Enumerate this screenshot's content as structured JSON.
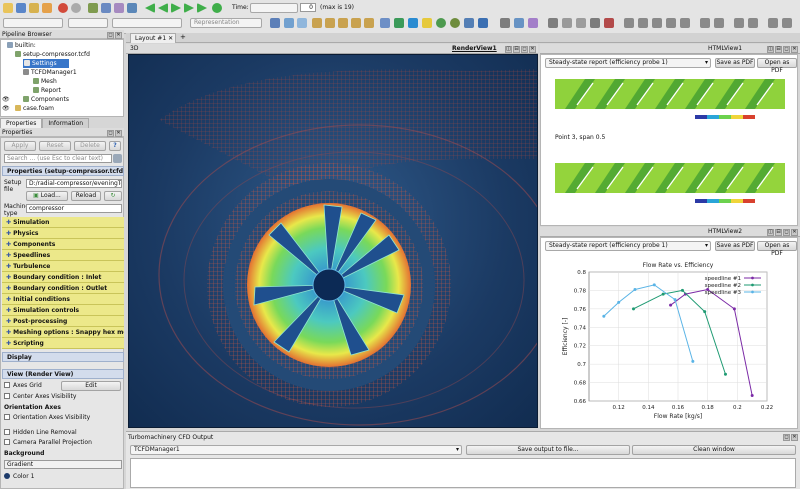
{
  "toolbar": {
    "time_label": "Time:",
    "time_value": "0",
    "time_max": "(max is 19)",
    "representation": "Representation"
  },
  "pipeline": {
    "title": "Pipeline Browser",
    "items": [
      {
        "label": "builtin:"
      },
      {
        "label": "setup-compressor.tcfd"
      },
      {
        "label": "Settings"
      },
      {
        "label": "TCFDManager1"
      },
      {
        "label": "Mesh"
      },
      {
        "label": "Report"
      },
      {
        "label": "Components"
      },
      {
        "label": "case.foam"
      }
    ]
  },
  "tabs": {
    "properties": "Properties",
    "information": "Information"
  },
  "properties": {
    "title": "Properties",
    "apply": "Apply",
    "reset": "Reset",
    "delete": "Delete",
    "help": "?",
    "search_placeholder": "Search ... (use Esc to clear text)",
    "group_title": "Properties (setup-compressor.tcfd)",
    "setup_file_label": "Setup file",
    "setup_file_value": "D:/radial-compressor/eveningTest/s",
    "load": "Load...",
    "reload": "Reload",
    "machine_type_label": "Machine type",
    "machine_type_value": "compressor",
    "sections": [
      "Simulation",
      "Physics",
      "Components",
      "Speedlines",
      "Turbulence",
      "Boundary condition : Inlet",
      "Boundary condition : Outlet",
      "Initial conditions",
      "Simulation controls",
      "Post-processing",
      "Meshing options : Snappy hex mes",
      "Scripting"
    ],
    "display": "Display",
    "view_header": "View (Render View)",
    "axes_grid": "Axes Grid",
    "edit": "Edit",
    "center_axes": "Center Axes Visibility",
    "orientation_axes_title": "Orientation Axes",
    "orientation_axes_vis": "Orientation Axes Visibility",
    "hidden_line": "Hidden Line Removal",
    "camera_parallel": "Camera Parallel Projection",
    "background_title": "Background",
    "background_value": "Gradient",
    "color1": "Color 1"
  },
  "layout_tab": "Layout #1",
  "render_view": {
    "title": "RenderView1"
  },
  "html_view1": {
    "title": "HTMLView1",
    "select": "Steady-state report (efficiency probe 1)",
    "save_pdf": "Save as PDF",
    "open_pdf": "Open as PDF",
    "caption": "Point 3, span 0.5"
  },
  "html_view2": {
    "title": "HTMLView2",
    "select": "Steady-state report (efficiency probe 1)",
    "save_pdf": "Save as PDF",
    "open_pdf": "Open as PDF"
  },
  "output": {
    "title": "Turbomachinery CFD Output",
    "select": "TCFDManager1",
    "save": "Save output to file...",
    "clean": "Clean window"
  },
  "chart_data": {
    "type": "line",
    "title": "Flow Rate vs. Efficiency",
    "xlabel": "Flow Rate [kg/s]",
    "ylabel": "Efficiency [-]",
    "xlim": [
      0.1,
      0.22
    ],
    "ylim": [
      0.66,
      0.8
    ],
    "xticks": [
      "0.12",
      "0.14",
      "0.16",
      "0.18",
      "0.2",
      "0.22"
    ],
    "yticks": [
      "0.66",
      "0.68",
      "0.7",
      "0.72",
      "0.74",
      "0.76",
      "0.78",
      "0.8"
    ],
    "legend_position": "top-right",
    "series": [
      {
        "name": "speedline #1",
        "color": "#7b2aa6",
        "x": [
          0.155,
          0.165,
          0.18,
          0.198,
          0.21
        ],
        "y": [
          0.764,
          0.776,
          0.781,
          0.76,
          0.666
        ]
      },
      {
        "name": "speedline #2",
        "color": "#1e9a72",
        "x": [
          0.13,
          0.15,
          0.163,
          0.178,
          0.192
        ],
        "y": [
          0.76,
          0.776,
          0.78,
          0.757,
          0.689
        ]
      },
      {
        "name": "speedline #3",
        "color": "#5ab4e6",
        "x": [
          0.11,
          0.12,
          0.131,
          0.144,
          0.158,
          0.17
        ],
        "y": [
          0.752,
          0.767,
          0.781,
          0.786,
          0.77,
          0.703
        ]
      }
    ]
  }
}
